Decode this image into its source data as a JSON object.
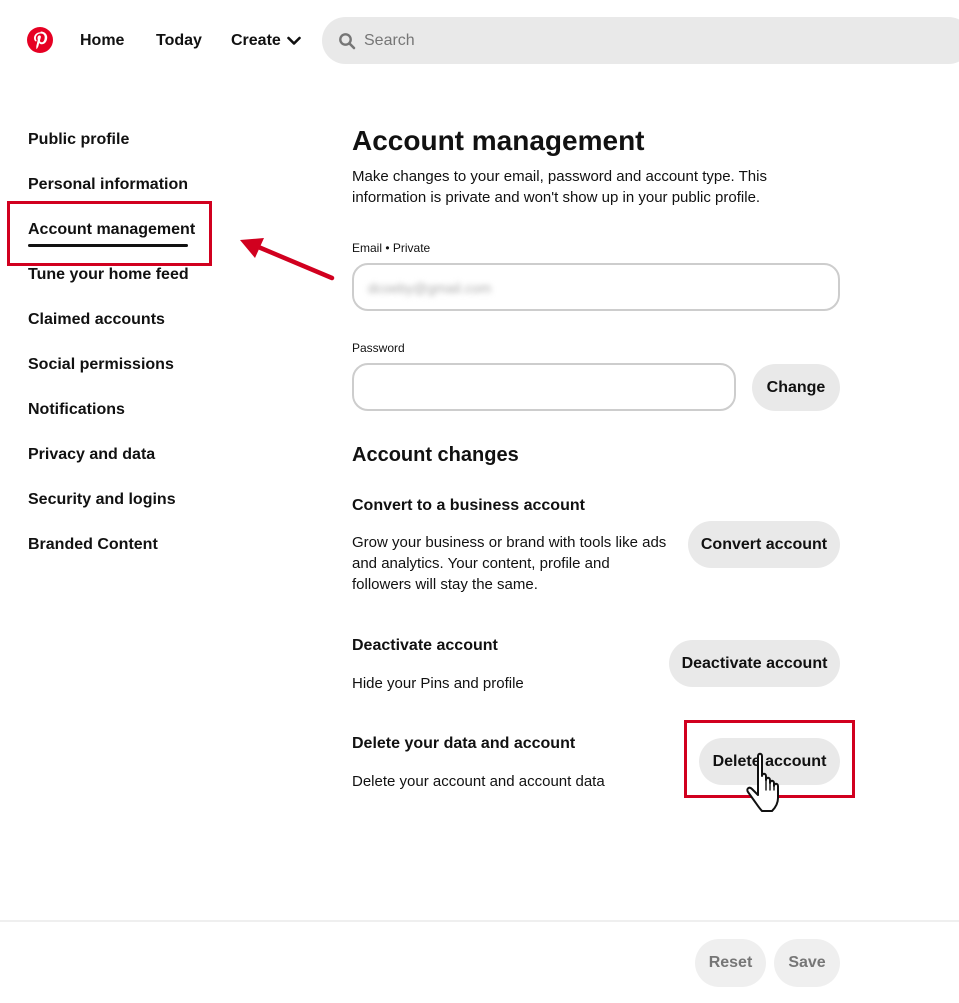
{
  "header": {
    "nav": {
      "home": "Home",
      "today": "Today",
      "create": "Create"
    },
    "search": {
      "placeholder": "Search"
    }
  },
  "sidebar": {
    "items": [
      {
        "label": "Public profile"
      },
      {
        "label": "Personal information"
      },
      {
        "label": "Account management",
        "active": true
      },
      {
        "label": "Tune your home feed"
      },
      {
        "label": "Claimed accounts"
      },
      {
        "label": "Social permissions"
      },
      {
        "label": "Notifications"
      },
      {
        "label": "Privacy and data"
      },
      {
        "label": "Security and logins"
      },
      {
        "label": "Branded Content"
      }
    ]
  },
  "main": {
    "title": "Account management",
    "intro": "Make changes to your email, password and account type. This information is private and won't show up in your public profile.",
    "email": {
      "label": "Email • Private",
      "value": "dcoeby@gmail.com"
    },
    "password": {
      "label": "Password",
      "value": "",
      "change_label": "Change"
    },
    "changes_title": "Account changes",
    "convert": {
      "title": "Convert to a business account",
      "desc": "Grow your business or brand with tools like ads and analytics. Your content, profile and followers will stay the same.",
      "button": "Convert account"
    },
    "deactivate": {
      "title": "Deactivate account",
      "desc": "Hide your Pins and profile",
      "button": "Deactivate account"
    },
    "delete": {
      "title": "Delete your data and account",
      "desc": "Delete your account and account data",
      "button": "Delete account"
    }
  },
  "footer": {
    "reset": "Reset",
    "save": "Save"
  },
  "colors": {
    "brand": "#e60023",
    "annotation": "#d1001f",
    "button_bg": "#e9e9e9"
  }
}
